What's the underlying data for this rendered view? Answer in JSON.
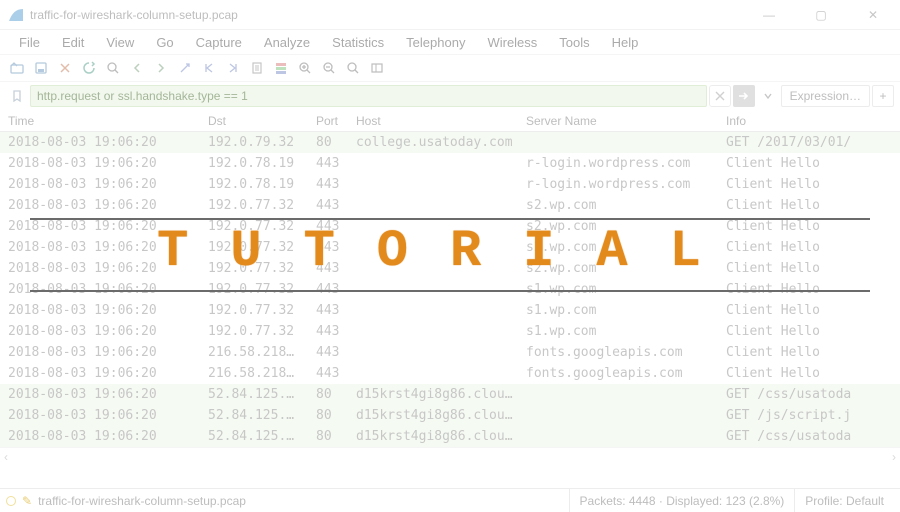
{
  "window": {
    "title": "traffic-for-wireshark-column-setup.pcap",
    "min_icon": "—",
    "max_icon": "▢",
    "close_icon": "✕"
  },
  "menu": [
    "File",
    "Edit",
    "View",
    "Go",
    "Capture",
    "Analyze",
    "Statistics",
    "Telephony",
    "Wireless",
    "Tools",
    "Help"
  ],
  "filter": {
    "text": "http.request or ssl.handshake.type == 1",
    "expression_label": "Expression…",
    "plus": "+"
  },
  "columns": {
    "time": "Time",
    "dst": "Dst",
    "port": "Port",
    "host": "Host",
    "srv": "Server Name",
    "info": "Info"
  },
  "rows": [
    {
      "green": true,
      "time": "2018-08-03 19:06:20",
      "dst": "192.0.79.32",
      "port": "80",
      "host": "college.usatoday.com",
      "srv": "",
      "info": "GET /2017/03/01/"
    },
    {
      "green": false,
      "time": "2018-08-03 19:06:20",
      "dst": "192.0.78.19",
      "port": "443",
      "host": "",
      "srv": "r-login.wordpress.com",
      "info": "Client Hello"
    },
    {
      "green": false,
      "time": "2018-08-03 19:06:20",
      "dst": "192.0.78.19",
      "port": "443",
      "host": "",
      "srv": "r-login.wordpress.com",
      "info": "Client Hello"
    },
    {
      "green": false,
      "time": "2018-08-03 19:06:20",
      "dst": "192.0.77.32",
      "port": "443",
      "host": "",
      "srv": "s2.wp.com",
      "info": "Client Hello"
    },
    {
      "green": false,
      "time": "2018-08-03 19:06:20",
      "dst": "192.0.77.32",
      "port": "443",
      "host": "",
      "srv": "s2.wp.com",
      "info": "Client Hello"
    },
    {
      "green": false,
      "time": "2018-08-03 19:06:20",
      "dst": "192.0.77.32",
      "port": "443",
      "host": "",
      "srv": "s2.wp.com",
      "info": "Client Hello"
    },
    {
      "green": false,
      "time": "2018-08-03 19:06:20",
      "dst": "192.0.77.32",
      "port": "443",
      "host": "",
      "srv": "s2.wp.com",
      "info": "Client Hello"
    },
    {
      "green": false,
      "time": "2018-08-03 19:06:20",
      "dst": "192.0.77.32",
      "port": "443",
      "host": "",
      "srv": "s1.wp.com",
      "info": "Client Hello"
    },
    {
      "green": false,
      "time": "2018-08-03 19:06:20",
      "dst": "192.0.77.32",
      "port": "443",
      "host": "",
      "srv": "s1.wp.com",
      "info": "Client Hello"
    },
    {
      "green": false,
      "time": "2018-08-03 19:06:20",
      "dst": "192.0.77.32",
      "port": "443",
      "host": "",
      "srv": "s1.wp.com",
      "info": "Client Hello"
    },
    {
      "green": false,
      "time": "2018-08-03 19:06:20",
      "dst": "216.58.218…",
      "port": "443",
      "host": "",
      "srv": "fonts.googleapis.com",
      "info": "Client Hello"
    },
    {
      "green": false,
      "time": "2018-08-03 19:06:20",
      "dst": "216.58.218…",
      "port": "443",
      "host": "",
      "srv": "fonts.googleapis.com",
      "info": "Client Hello"
    },
    {
      "green": true,
      "time": "2018-08-03 19:06:20",
      "dst": "52.84.125.…",
      "port": "80",
      "host": "d15krst4gi8g86.clou…",
      "srv": "",
      "info": "GET /css/usatoda"
    },
    {
      "green": true,
      "time": "2018-08-03 19:06:20",
      "dst": "52.84.125.…",
      "port": "80",
      "host": "d15krst4gi8g86.clou…",
      "srv": "",
      "info": "GET /js/script.j"
    },
    {
      "green": true,
      "time": "2018-08-03 19:06:20",
      "dst": "52.84.125.…",
      "port": "80",
      "host": "d15krst4gi8g86.clou…",
      "srv": "",
      "info": "GET /css/usatoda"
    }
  ],
  "overlay": {
    "text": "TUTORIAL"
  },
  "status": {
    "file": "traffic-for-wireshark-column-setup.pcap",
    "packets": "Packets: 4448 · Displayed: 123 (2.8%)",
    "profile": "Profile: Default"
  }
}
